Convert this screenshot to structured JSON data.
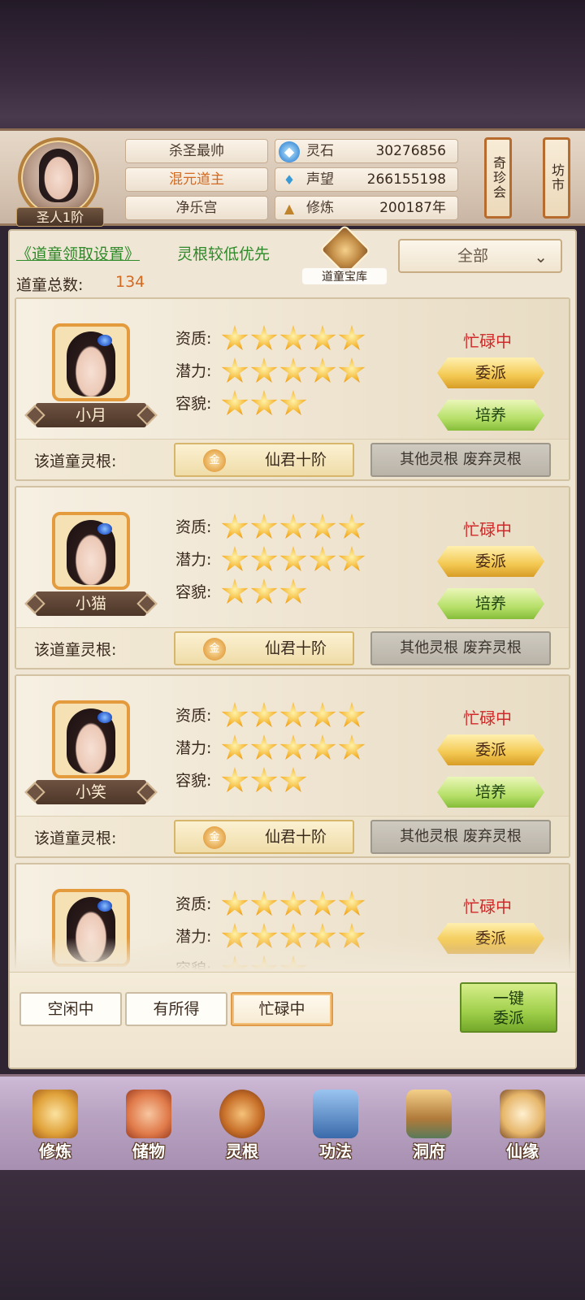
{
  "player": {
    "rank": "圣人1阶",
    "name": "杀圣最帅",
    "title": "混元道主",
    "sect": "净乐宫"
  },
  "stats": [
    {
      "icon": "spirit-stone-icon",
      "label": "灵石",
      "value": "30276856"
    },
    {
      "icon": "reputation-icon",
      "label": "声望",
      "value": "266155198"
    },
    {
      "icon": "cultivation-icon",
      "label": "修炼",
      "value": "200187年"
    }
  ],
  "side_banners": {
    "treasure_fair": "奇珍会",
    "market": "坊市"
  },
  "panel": {
    "settings_link": "《道童领取设置》",
    "priority_link": "灵根较低优先",
    "total_label": "道童总数:",
    "total_value": "134",
    "treasury_label": "道童宝库",
    "filter_value": "全部"
  },
  "labels": {
    "quality": "资质:",
    "potential": "潜力:",
    "appearance": "容貌:",
    "root": "该道童灵根:",
    "dispatch": "委派",
    "train": "培养",
    "other_roots": "其他灵根 废弃灵根",
    "gold": "金"
  },
  "cards": [
    {
      "name": "小月",
      "status": "忙碌中",
      "root": "仙君十阶",
      "quality_stars": 5,
      "potential_stars": 5,
      "appearance_stars": 3
    },
    {
      "name": "小猫",
      "status": "忙碌中",
      "root": "仙君十阶",
      "quality_stars": 5,
      "potential_stars": 5,
      "appearance_stars": 3
    },
    {
      "name": "小笑",
      "status": "忙碌中",
      "root": "仙君十阶",
      "quality_stars": 5,
      "potential_stars": 5,
      "appearance_stars": 3
    },
    {
      "name": "",
      "status": "忙碌中",
      "root": "",
      "quality_stars": 5,
      "potential_stars": 5,
      "appearance_stars": 3
    }
  ],
  "filter_tabs": [
    {
      "label": "空闲中",
      "active": false
    },
    {
      "label": "有所得",
      "active": false
    },
    {
      "label": "忙碌中",
      "active": true
    }
  ],
  "one_click_dispatch": [
    "一键",
    "委派"
  ],
  "nav": [
    {
      "label": "修炼",
      "icon": "cultivate-icon"
    },
    {
      "label": "储物",
      "icon": "storage-bag-icon"
    },
    {
      "label": "灵根",
      "icon": "spirit-root-icon"
    },
    {
      "label": "功法",
      "icon": "technique-book-icon"
    },
    {
      "label": "洞府",
      "icon": "cave-dwelling-icon"
    },
    {
      "label": "仙缘",
      "icon": "immortal-fate-icon"
    }
  ],
  "colors": {
    "busy": "#d1282a",
    "link": "#2f8a2a",
    "count": "#d26a22"
  }
}
